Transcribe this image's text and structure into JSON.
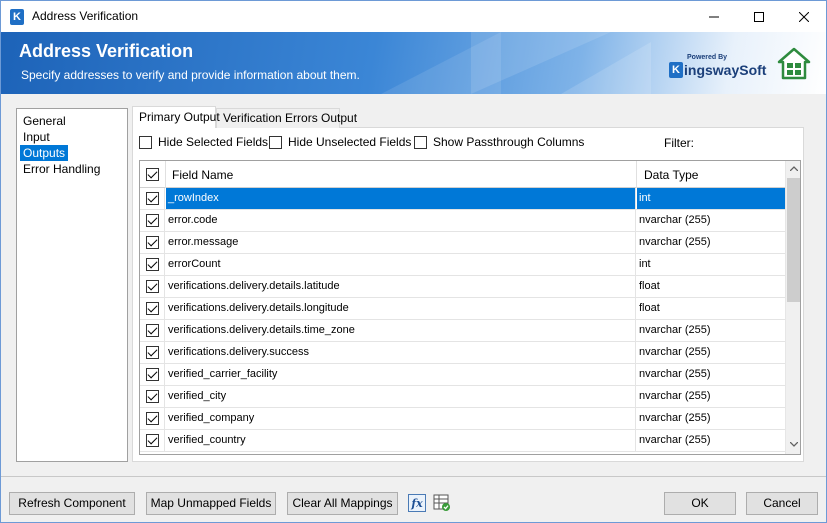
{
  "window": {
    "title": "Address Verification",
    "app_icon_letter": "K"
  },
  "banner": {
    "title": "Address Verification",
    "subtitle": "Specify addresses to verify and provide information about them.",
    "logo_powered": "Powered By",
    "logo_name": "ingswaySoft",
    "logo_letter": "K"
  },
  "nav": {
    "items": [
      {
        "label": "General"
      },
      {
        "label": "Input"
      },
      {
        "label": "Outputs"
      },
      {
        "label": "Error Handling"
      }
    ],
    "active_index": 2
  },
  "tabs": [
    {
      "label": "Primary Output"
    },
    {
      "label": "Verification Errors Output"
    }
  ],
  "options": {
    "hide_selected": "Hide Selected Fields",
    "hide_unselected": "Hide Unselected Fields",
    "show_passthrough": "Show Passthrough Columns",
    "filter_label": "Filter:",
    "filter_value": ""
  },
  "grid": {
    "columns": {
      "name": "Field Name",
      "type": "Data Type"
    },
    "rows": [
      {
        "name": "_rowIndex",
        "type": "int"
      },
      {
        "name": "error.code",
        "type": "nvarchar (255)"
      },
      {
        "name": "error.message",
        "type": "nvarchar (255)"
      },
      {
        "name": "errorCount",
        "type": "int"
      },
      {
        "name": "verifications.delivery.details.latitude",
        "type": "float"
      },
      {
        "name": "verifications.delivery.details.longitude",
        "type": "float"
      },
      {
        "name": "verifications.delivery.details.time_zone",
        "type": "nvarchar (255)"
      },
      {
        "name": "verifications.delivery.success",
        "type": "nvarchar (255)"
      },
      {
        "name": "verified_carrier_facility",
        "type": "nvarchar (255)"
      },
      {
        "name": "verified_city",
        "type": "nvarchar (255)"
      },
      {
        "name": "verified_company",
        "type": "nvarchar (255)"
      },
      {
        "name": "verified_country",
        "type": "nvarchar (255)"
      }
    ],
    "selected_index": 0
  },
  "footer": {
    "refresh": "Refresh Component",
    "map_unmapped": "Map Unmapped Fields",
    "clear_all": "Clear All Mappings",
    "fx_icon": "fx",
    "ok": "OK",
    "cancel": "Cancel"
  },
  "colors": {
    "selection": "#0078d7",
    "banner_start": "#1d63b8",
    "window_border": "#6d9ad6"
  }
}
